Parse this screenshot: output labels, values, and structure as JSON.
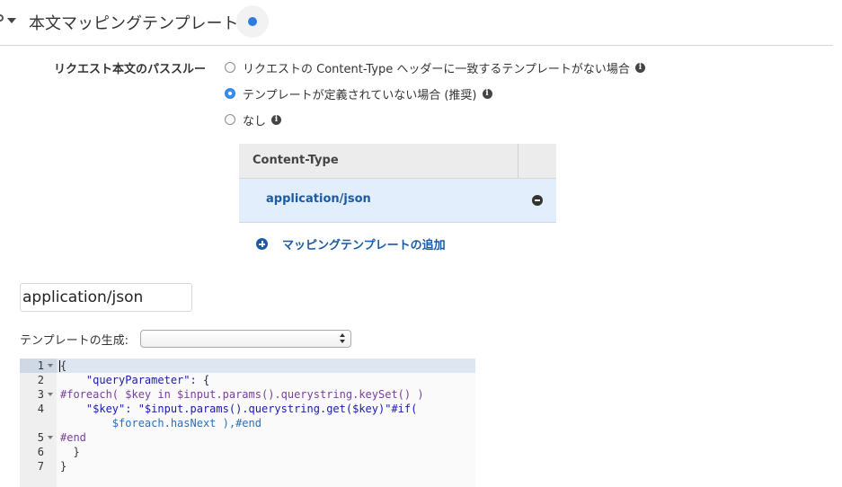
{
  "section": {
    "title": "本文マッピングテンプレート"
  },
  "passthrough": {
    "label": "リクエスト本文のパススルー",
    "options": [
      {
        "label": "リクエストの Content-Type ヘッダーに一致するテンプレートがない場合",
        "selected": false
      },
      {
        "label": "テンプレートが定義されていない場合 (推奨)",
        "selected": true
      },
      {
        "label": "なし",
        "selected": false
      }
    ]
  },
  "content_type_table": {
    "header": "Content-Type",
    "rows": [
      "application/json"
    ]
  },
  "add_mapping_label": "マッピングテンプレートの追加",
  "content_type_input": {
    "value": "application/json"
  },
  "generate_template": {
    "label": "テンプレートの生成:",
    "selected": ""
  },
  "editor": {
    "lines": [
      {
        "number": "1",
        "foldable": true,
        "text": "{"
      },
      {
        "number": "2",
        "foldable": false,
        "text": "    \"queryParameter\": {"
      },
      {
        "number": "3",
        "foldable": true,
        "text": "#foreach( $key in $input.params().querystring.keySet() )"
      },
      {
        "number": "4",
        "foldable": false,
        "text": "    \"$key\": \"$input.params().querystring.get($key)\"#if("
      },
      {
        "number": "",
        "foldable": false,
        "text": "        $foreach.hasNext ),#end"
      },
      {
        "number": "5",
        "foldable": true,
        "text": "#end"
      },
      {
        "number": "6",
        "foldable": false,
        "text": "  }"
      },
      {
        "number": "7",
        "foldable": false,
        "text": "}"
      }
    ]
  },
  "colors": {
    "accent": "#2f7be0",
    "link": "#1a5aa6",
    "selected_row_bg": "#e2eefc"
  }
}
